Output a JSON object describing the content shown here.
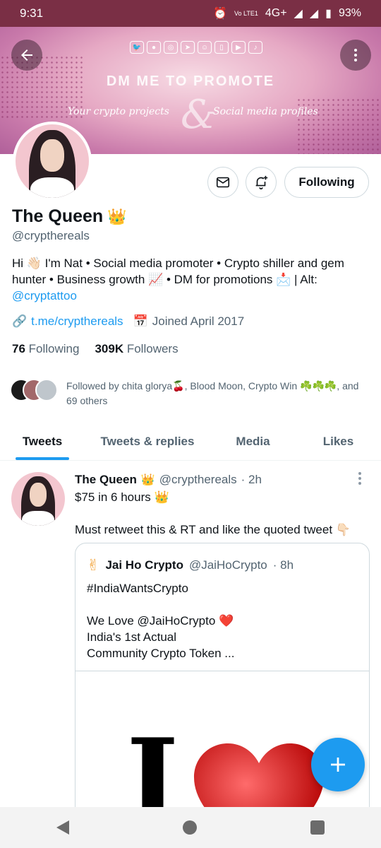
{
  "status_bar": {
    "time": "9:31",
    "network": "4G+",
    "volte": "Vo LTE1",
    "battery": "93%"
  },
  "banner": {
    "headline": "DM ME TO PROMOTE",
    "sub_left": "Your crypto projects",
    "sub_right": "Social media profiles",
    "ampersand": "&"
  },
  "profile": {
    "name": "The Queen",
    "handle": "@crypthereals",
    "bio_text": "Hi 👋🏻 I'm Nat • Social media promoter • Crypto shiller and gem hunter • Business growth 📈 • DM for promotions 📩 | Alt:",
    "bio_link": "@cryptattoo",
    "url": "t.me/crypthereals",
    "joined": "Joined April 2017",
    "following_count": "76",
    "following_label": "Following",
    "followers_count": "309K",
    "followers_label": "Followers",
    "following_button": "Following",
    "followed_by": "Followed by chita glorya🍒, Blood Moon, Crypto Win ☘️☘️☘️, and 69 others"
  },
  "tabs": [
    "Tweets",
    "Tweets & replies",
    "Media",
    "Likes"
  ],
  "tweet": {
    "author": "The Queen",
    "handle": "@crypthereals",
    "time": "· 2h",
    "line1": "$75 in 6 hours 👑",
    "line2": "Must retweet this & RT and like the quoted tweet 👇🏻",
    "quote": {
      "author": "Jai Ho Crypto",
      "handle": "@JaiHoCrypto",
      "time": "· 8h",
      "hashtag": "#IndiaWantsCrypto",
      "line1": "We Love @JaiHoCrypto ❤️",
      "line2": "India's 1st Actual",
      "line3": "Community Crypto Token ...",
      "media_letter": "I"
    }
  },
  "colors": {
    "accent": "#1d9bf0",
    "status_bar": "#7a2f45",
    "text_muted": "#536471"
  }
}
